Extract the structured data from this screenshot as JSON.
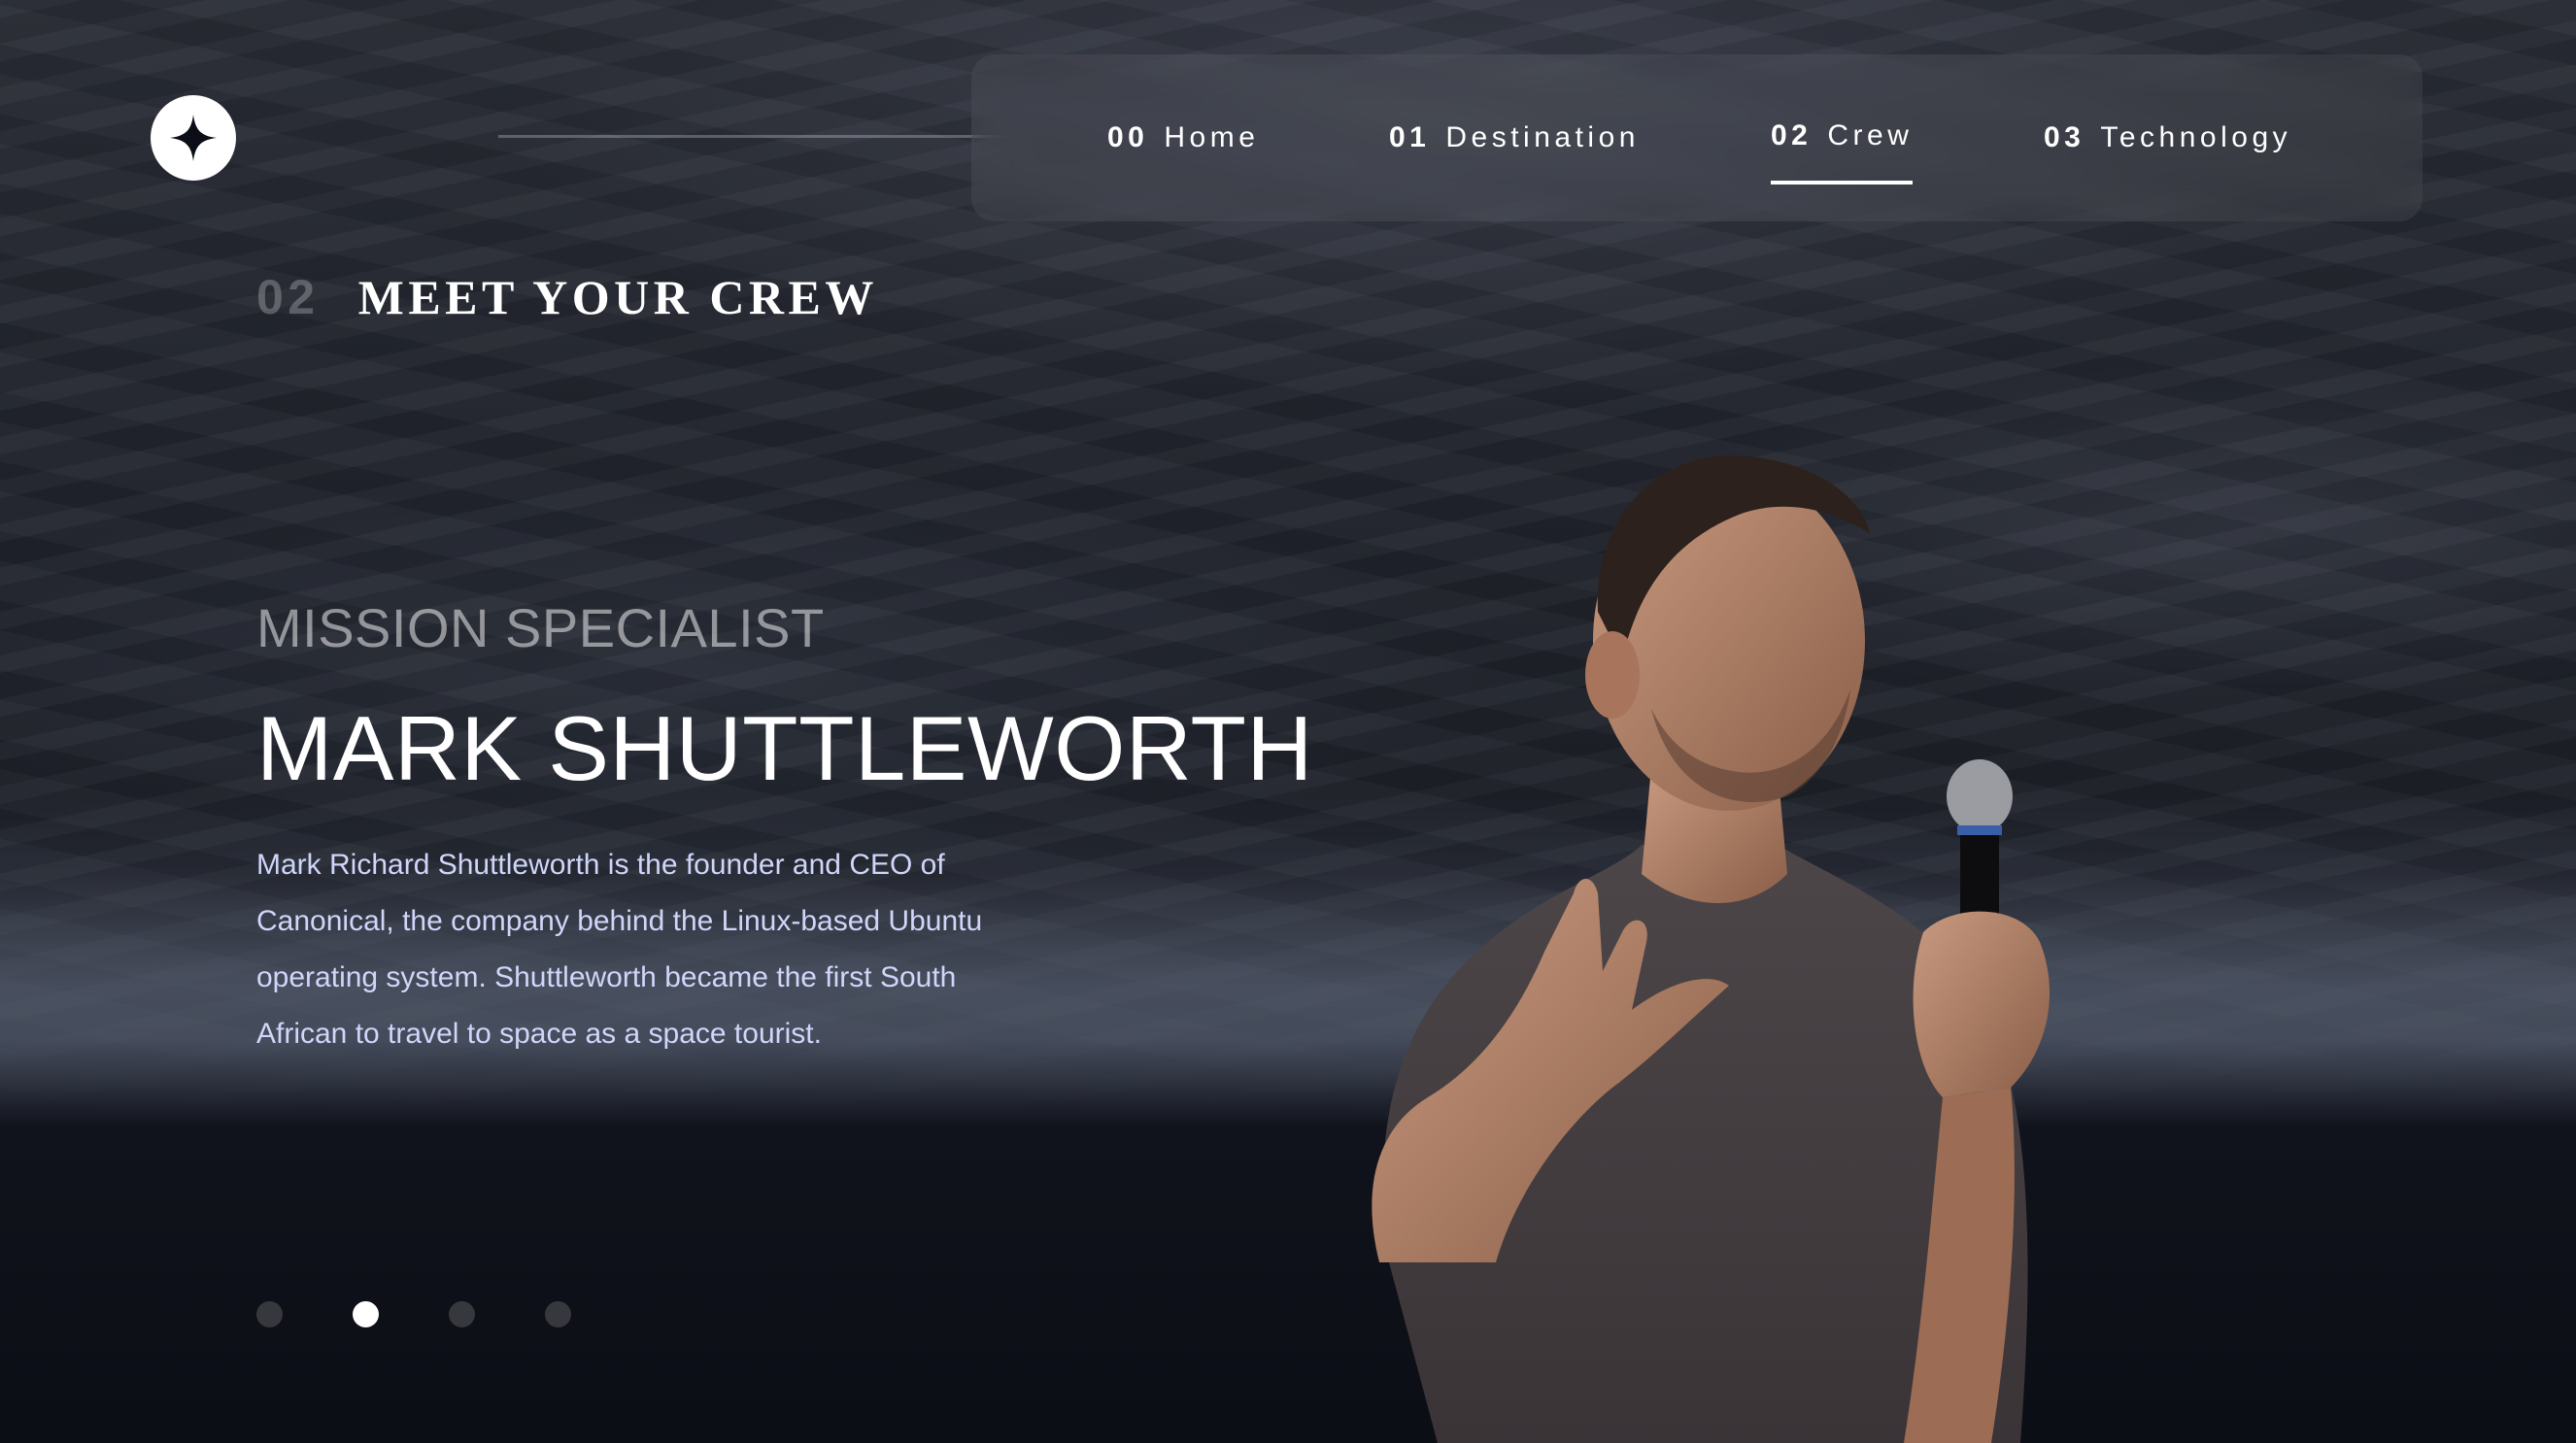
{
  "nav": {
    "items": [
      {
        "num": "00",
        "label": "Home"
      },
      {
        "num": "01",
        "label": "Destination"
      },
      {
        "num": "02",
        "label": "Crew"
      },
      {
        "num": "03",
        "label": "Technology"
      }
    ],
    "active_index": 2
  },
  "heading": {
    "num": "02",
    "title": "MEET YOUR CREW"
  },
  "crew": {
    "role": "MISSION SPECIALIST",
    "name": "MARK SHUTTLEWORTH",
    "bio": "Mark Richard Shuttleworth is the founder and CEO of Canonical, the company behind the Linux-based Ubuntu operating system. Shuttleworth became the first South African to travel to space as a space tourist."
  },
  "slider": {
    "count": 4,
    "active_index": 1
  },
  "icons": {
    "logo": "four-point-star-icon"
  },
  "colors": {
    "background": "#0b0d17",
    "text": "#ffffff",
    "body_text": "#d0d6f9"
  }
}
